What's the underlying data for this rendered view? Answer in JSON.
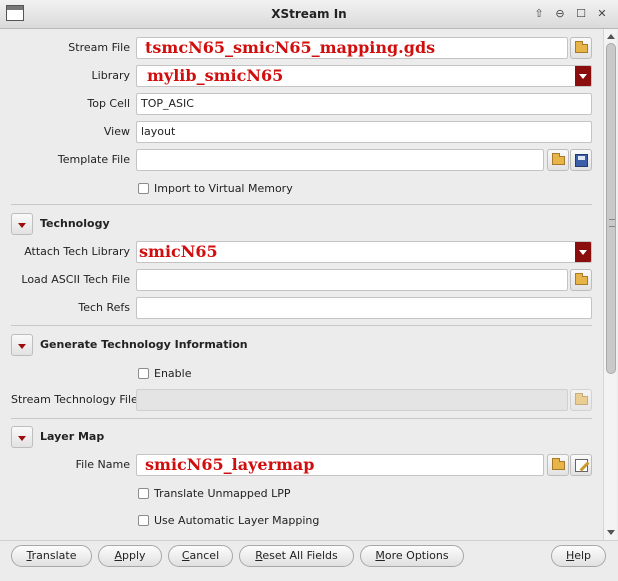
{
  "window": {
    "title": "XStream In",
    "controls": [
      "⇧",
      "⊖",
      "☐",
      "✕"
    ]
  },
  "main": {
    "stream_file": {
      "label": "Stream File",
      "value": "tsmcN65_smicN65_mapping.gds"
    },
    "library": {
      "label": "Library",
      "value": "mylib_smicN65"
    },
    "top_cell": {
      "label": "Top Cell",
      "value": "TOP_ASIC"
    },
    "view": {
      "label": "View",
      "value": "layout"
    },
    "template_file": {
      "label": "Template File",
      "value": ""
    },
    "import_virtual_memory": {
      "label": "Import to Virtual Memory",
      "checked": false
    }
  },
  "technology": {
    "title": "Technology",
    "attach_tech_library": {
      "label": "Attach Tech Library",
      "value": "smicN65"
    },
    "load_ascii_tech_file": {
      "label": "Load ASCII Tech File",
      "value": ""
    },
    "tech_refs": {
      "label": "Tech Refs",
      "value": ""
    }
  },
  "generate_tech": {
    "title": "Generate Technology Information",
    "enable": {
      "label": "Enable",
      "checked": false
    },
    "stream_tech_file": {
      "label": "Stream Technology File",
      "value": ""
    }
  },
  "layer_map": {
    "title": "Layer Map",
    "file_name": {
      "label": "File Name",
      "value": "smicN65_layermap"
    },
    "translate_unmapped": {
      "label": "Translate Unmapped LPP",
      "checked": false
    },
    "auto_layer_mapping": {
      "label": "Use Automatic Layer Mapping",
      "checked": false
    }
  },
  "buttons": {
    "translate": {
      "first": "T",
      "rest": "ranslate"
    },
    "apply": {
      "first": "A",
      "rest": "pply"
    },
    "cancel": {
      "first": "C",
      "rest": "ancel"
    },
    "reset": {
      "first": "R",
      "rest": "eset All Fields"
    },
    "more": {
      "first": "M",
      "rest": "ore Options"
    },
    "help": {
      "first": "H",
      "rest": "elp"
    }
  },
  "colors": {
    "highlight_text": "#d10e0e",
    "combo_arrow": "#8a0e0e"
  }
}
